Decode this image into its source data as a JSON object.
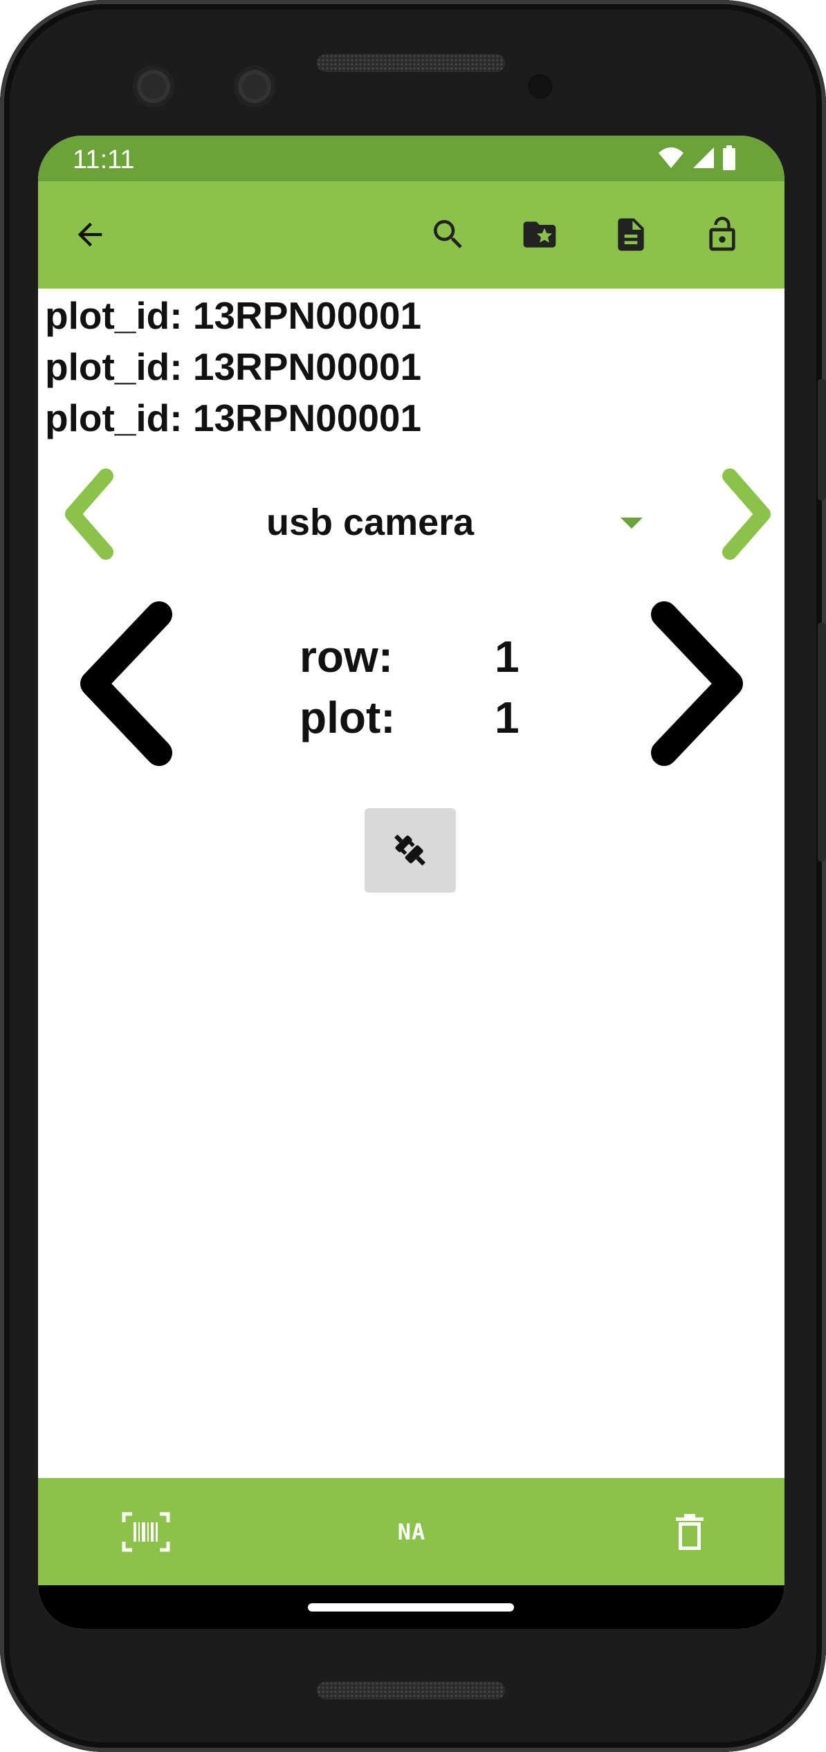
{
  "status_bar": {
    "time": "11:11"
  },
  "toolbar": {
    "back_icon": "arrow-back-icon",
    "actions": [
      "search-icon",
      "folder-star-icon",
      "document-icon",
      "lock-open-icon"
    ]
  },
  "info_lines": [
    "plot_id: 13RPN00001",
    "plot_id: 13RPN00001",
    "plot_id: 13RPN00001"
  ],
  "trait_picker": {
    "selected": "usb camera"
  },
  "range": {
    "row_label": "row:",
    "row_value": "1",
    "plot_label": "plot:",
    "plot_value": "1"
  },
  "connect_button": {
    "icon": "plug-connect-icon"
  },
  "bottom_bar": {
    "barcode_icon": "barcode-scan-icon",
    "na_label": "NA",
    "delete_icon": "trash-icon"
  },
  "colors": {
    "status_bar": "#6ba23a",
    "app_bar": "#8bc34a",
    "accent_arrow": "#8bc34a"
  }
}
